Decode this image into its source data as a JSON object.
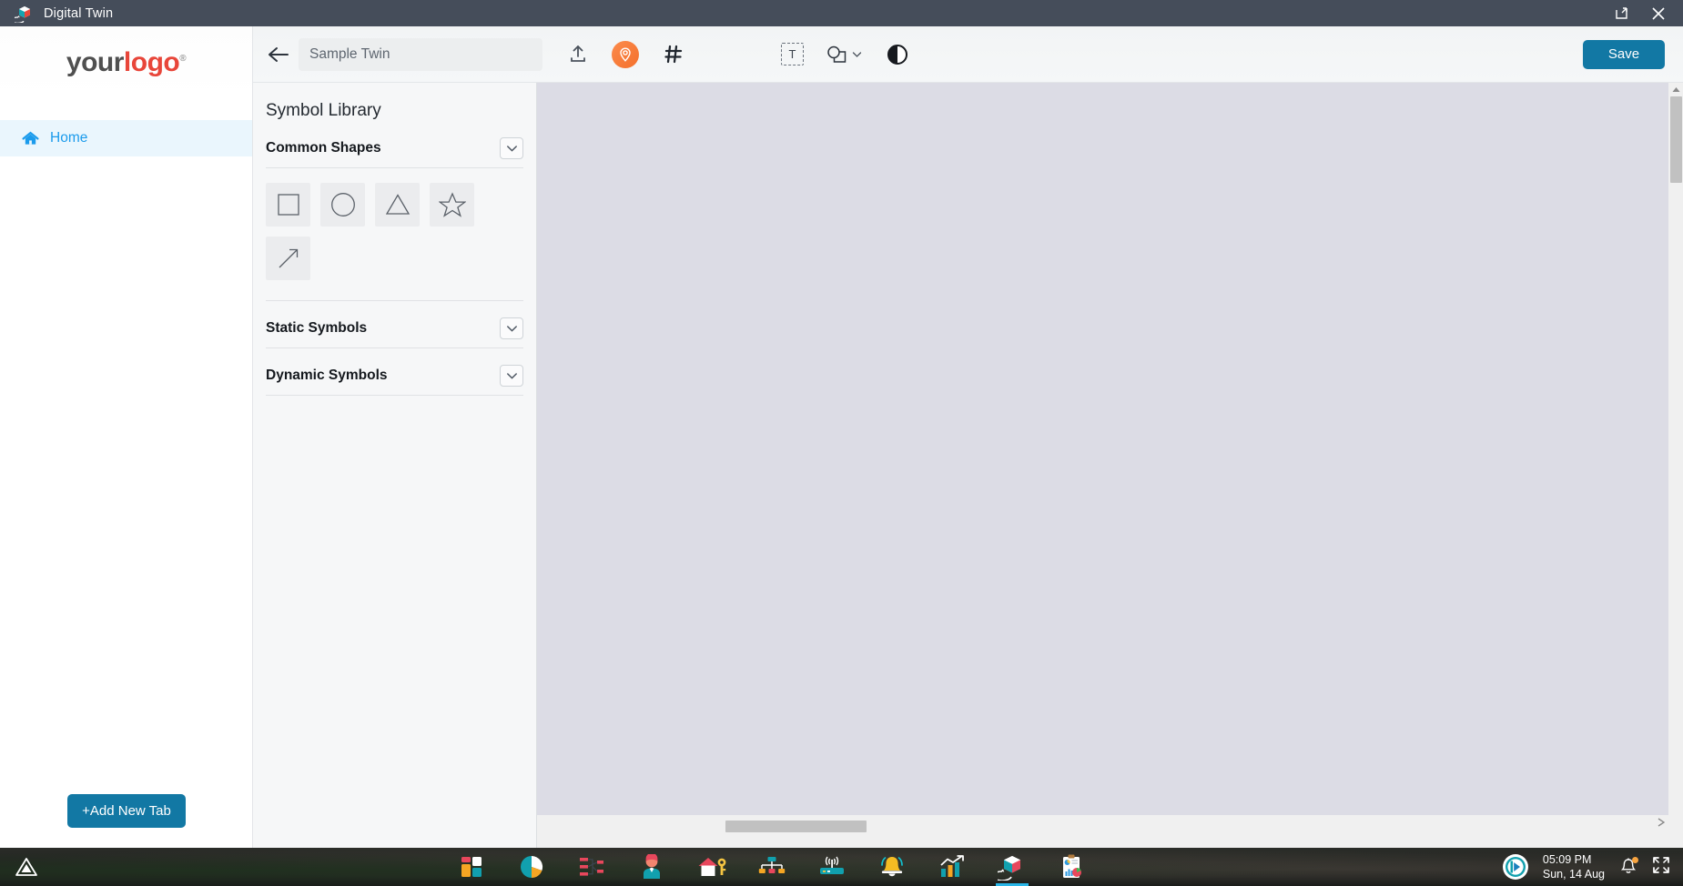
{
  "window": {
    "title": "Digital Twin",
    "app_icon": "digital-twin-cube-icon",
    "controls": [
      {
        "name": "restore-down",
        "glyph": "restore-icon"
      },
      {
        "name": "close",
        "glyph": "close-icon"
      }
    ]
  },
  "sidebar": {
    "logo": {
      "part1": "your",
      "part2": "logo",
      "registered": "®"
    },
    "items": [
      {
        "label": "Home",
        "icon": "home-icon",
        "active": true
      }
    ],
    "add_tab_label": "+Add New Tab"
  },
  "toolbar": {
    "back_icon": "back-arrow-icon",
    "twin_name_value": "Sample Twin",
    "twin_name_placeholder": "Sample Twin",
    "left_tools": [
      {
        "name": "upload-icon",
        "label": "Upload"
      },
      {
        "name": "location-pin-icon",
        "label": "Place Marker",
        "active": true
      },
      {
        "name": "grid-hash-icon",
        "label": "Grid"
      }
    ],
    "center_tools": [
      {
        "name": "text-tool-icon",
        "label": "T"
      },
      {
        "name": "shapes-tool-icon",
        "label": "Shapes"
      },
      {
        "name": "contrast-icon",
        "label": "Contrast"
      }
    ],
    "save_label": "Save",
    "accent_color": "#1278a4",
    "pin_color": "#f4702c"
  },
  "symbol_panel": {
    "title": "Symbol Library",
    "sections": [
      {
        "label": "Common Shapes",
        "expanded": true
      },
      {
        "label": "Static Symbols",
        "expanded": false
      },
      {
        "label": "Dynamic Symbols",
        "expanded": false
      }
    ],
    "common_shapes": [
      {
        "name": "square-shape",
        "label": "Square"
      },
      {
        "name": "circle-shape",
        "label": "Circle"
      },
      {
        "name": "triangle-shape",
        "label": "Triangle"
      },
      {
        "name": "star-shape",
        "label": "Star"
      },
      {
        "name": "arrow-shape",
        "label": "Arrow"
      }
    ]
  },
  "canvas": {
    "background_color": "#dcdce5",
    "scrollbars": {
      "vertical": true,
      "horizontal": true
    }
  },
  "taskbar": {
    "start_icon": "start-triangle-icon",
    "apps": [
      {
        "name": "dashboard-icon",
        "label": "Dashboard"
      },
      {
        "name": "pie-chart-icon",
        "label": "Analytics"
      },
      {
        "name": "flow-diagram-icon",
        "label": "Workflow"
      },
      {
        "name": "user-profile-icon",
        "label": "Users"
      },
      {
        "name": "home-key-icon",
        "label": "Assets"
      },
      {
        "name": "hierarchy-icon",
        "label": "Hierarchy"
      },
      {
        "name": "router-antenna-icon",
        "label": "Devices"
      },
      {
        "name": "bell-alarm-icon",
        "label": "Alarms"
      },
      {
        "name": "trend-chart-icon",
        "label": "Trends"
      },
      {
        "name": "digital-twin-cube-icon",
        "label": "Digital Twin",
        "active": true
      },
      {
        "name": "report-clipboard-icon",
        "label": "Reports"
      }
    ],
    "tray": {
      "avatar_icon": "user-avatar-icon",
      "time": "05:09 PM",
      "date": "Sun, 14 Aug",
      "notification_icon": "bell-icon",
      "notification_badge": true,
      "fullscreen_icon": "expand-icon"
    }
  }
}
